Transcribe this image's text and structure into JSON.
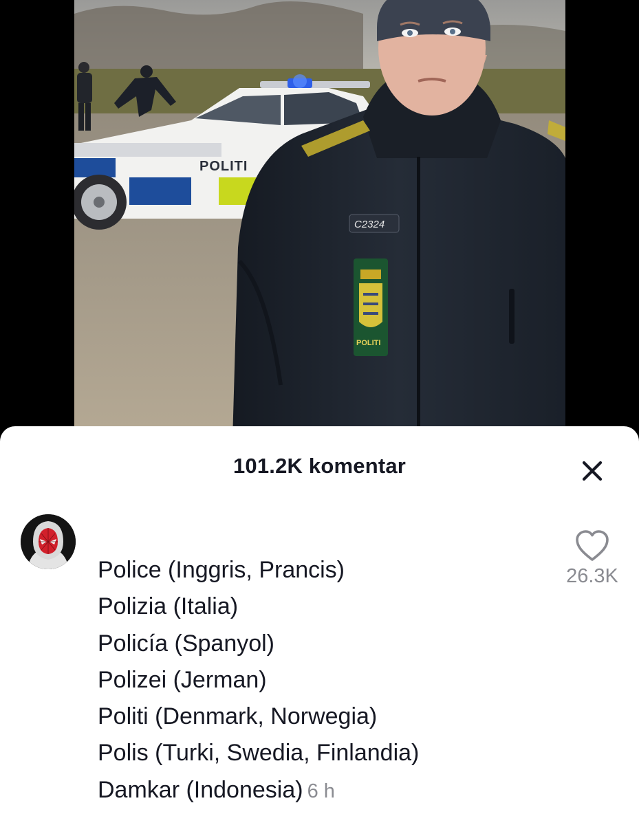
{
  "video": {
    "car_text": "POLITI",
    "badge_number": "C2324",
    "patch_text": "POLITI"
  },
  "comments_header": {
    "title": "101.2K komentar"
  },
  "comment": {
    "lines": [
      "Police (Inggris, Prancis)",
      "Polizia (Italia)",
      "Policía (Spanyol)",
      "Polizei (Jerman)",
      "Politi (Denmark, Norwegia)",
      "Polis (Turki, Swedia, Finlandia)",
      "Damkar (Indonesia)"
    ],
    "timestamp": "6 h",
    "like_count": "26.3K"
  },
  "colors": {
    "text_primary": "#161823",
    "text_secondary": "#8a8b91",
    "police_yellow": "#c8d81e",
    "police_blue": "#1e4d9b",
    "uniform": "#1f2530"
  },
  "icons": {
    "close": "close-icon",
    "like": "heart-outline-icon",
    "avatar": "spiderman-avatar"
  }
}
